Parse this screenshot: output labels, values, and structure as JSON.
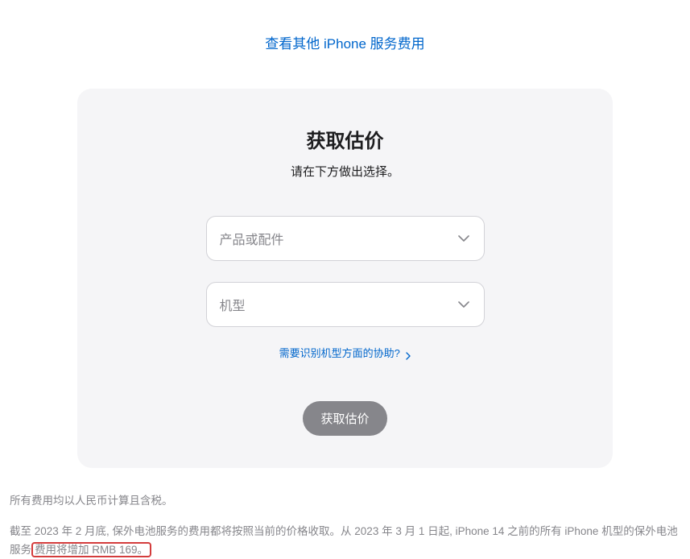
{
  "topLink": {
    "label": "查看其他 iPhone 服务费用"
  },
  "card": {
    "title": "获取估价",
    "subtitle": "请在下方做出选择。",
    "select1": {
      "placeholder": "产品或配件"
    },
    "select2": {
      "placeholder": "机型"
    },
    "helpLink": {
      "label": "需要识别机型方面的协助?"
    },
    "submit": {
      "label": "获取估价"
    }
  },
  "disclaimer": {
    "line1": "所有费用均以人民币计算且含税。",
    "line2_prefix": "截至 2023 年 2 月底, 保外电池服务的费用都将按照当前的价格收取。从 2023 年 3 月 1 日起, iPhone 14 之前的所有 iPhone 机型的保外电池服务",
    "line2_highlight": "费用将增加 RMB 169。"
  }
}
